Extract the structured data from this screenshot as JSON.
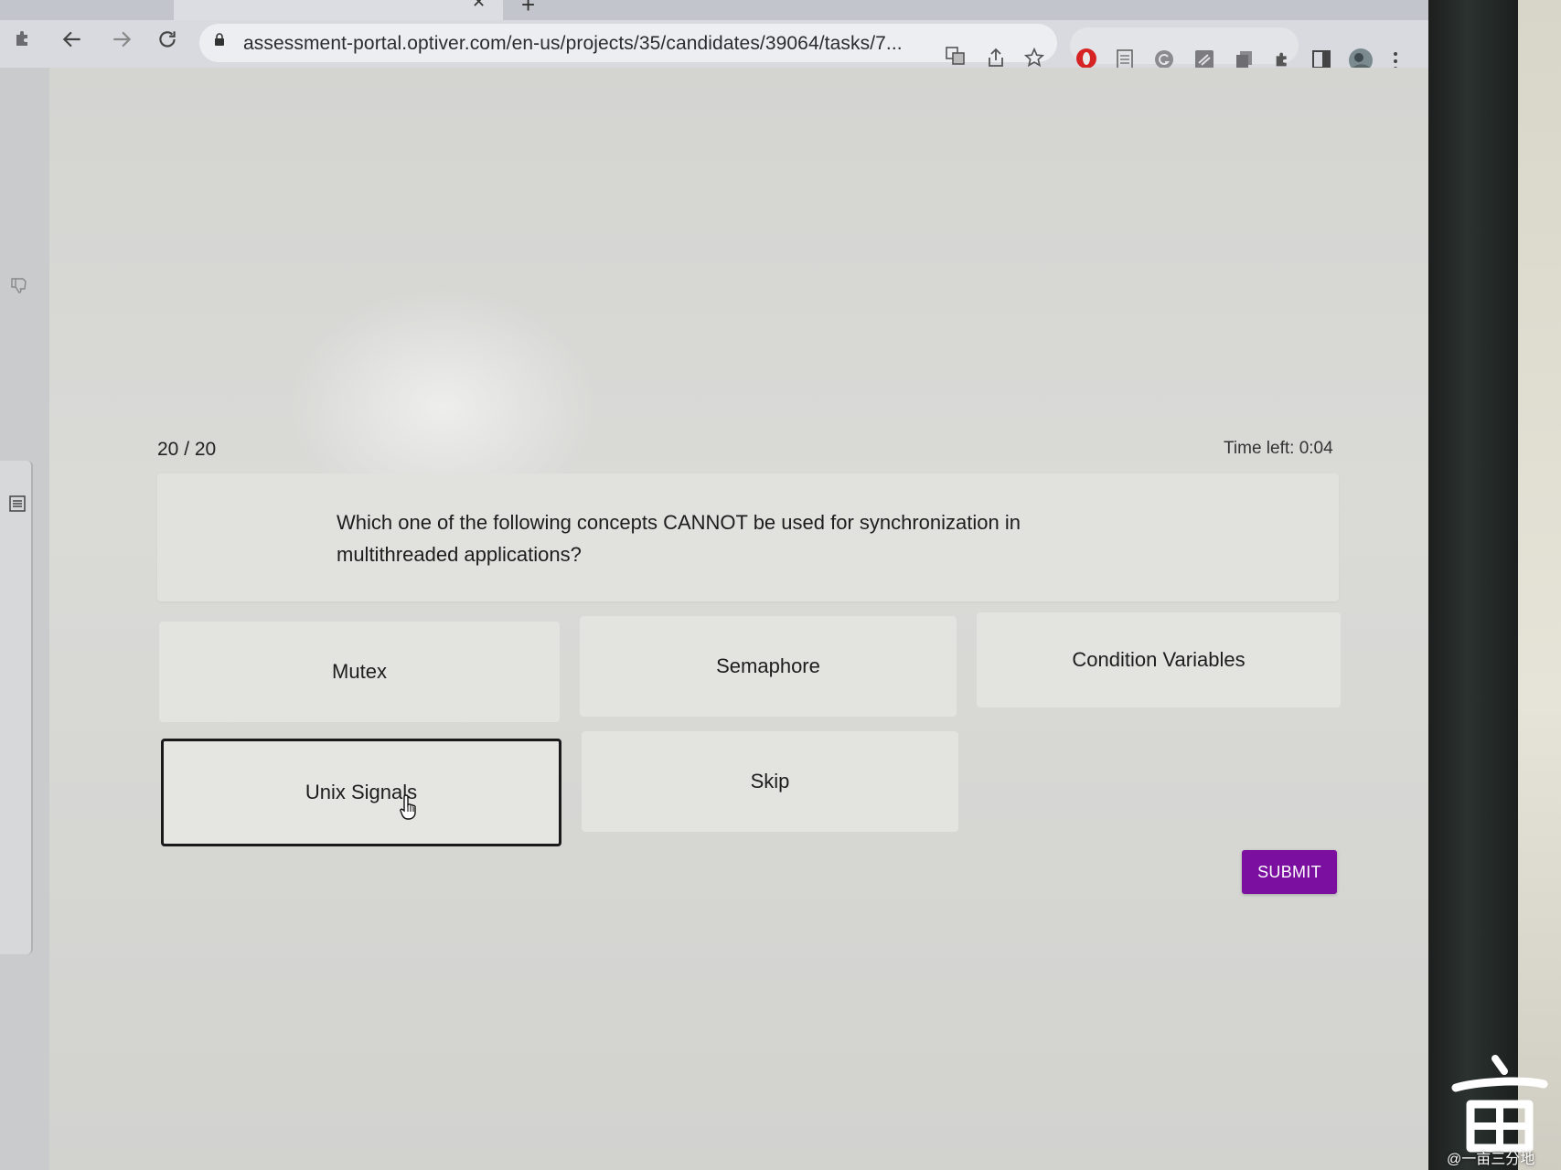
{
  "browser": {
    "url": "assessment-portal.optiver.com/en-us/projects/35/candidates/39064/tasks/7...",
    "icons": [
      "extensions-icon",
      "back-icon",
      "forward-icon",
      "reload-icon",
      "lock-icon",
      "translate-icon",
      "share-icon",
      "star-icon",
      "opera-icon",
      "document-icon",
      "grammarly-icon",
      "notes-icon",
      "copy-icon",
      "puzzle-icon",
      "sidepanel-icon",
      "profile-avatar",
      "menu-icon"
    ]
  },
  "quiz": {
    "counter": "20 / 20",
    "time_left": "Time left: 0:04",
    "question": "Which one of the following concepts CANNOT be used for synchronization in multithreaded applications?",
    "options": [
      {
        "label": "Mutex",
        "selected": false
      },
      {
        "label": "Semaphore",
        "selected": false
      },
      {
        "label": "Condition Variables",
        "selected": false
      },
      {
        "label": "Unix Signals",
        "selected": true
      },
      {
        "label": "Skip",
        "selected": false
      }
    ],
    "submit_label": "SUBMIT",
    "accent_color": "#7a0fa0"
  },
  "watermark": {
    "text": "@一亩三分地"
  }
}
